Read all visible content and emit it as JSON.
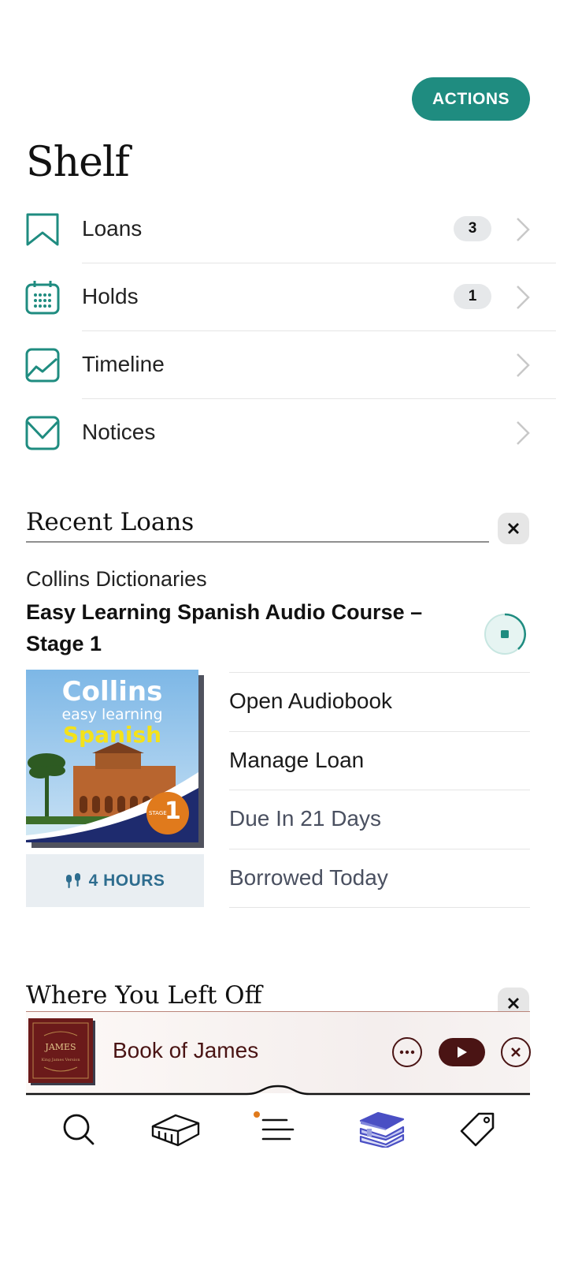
{
  "header": {
    "actions_label": "ACTIONS",
    "title": "Shelf"
  },
  "menu": [
    {
      "label": "Loans",
      "badge": "3",
      "icon": "bookmark-icon"
    },
    {
      "label": "Holds",
      "badge": "1",
      "icon": "calendar-icon"
    },
    {
      "label": "Timeline",
      "badge": null,
      "icon": "chart-icon"
    },
    {
      "label": "Notices",
      "badge": null,
      "icon": "envelope-icon"
    }
  ],
  "recent_loans": {
    "title": "Recent Loans",
    "author": "Collins Dictionaries",
    "book_title": "Easy Learning Spanish Audio Course – Stage 1",
    "cover": {
      "brand": "Collins",
      "line1": "easy learning",
      "line2": "Spanish",
      "stage_label": "STAGE",
      "stage_num": "1"
    },
    "duration": "4 HOURS",
    "actions": [
      "Open Audiobook",
      "Manage Loan",
      "Due In 21 Days",
      "Borrowed Today"
    ]
  },
  "where_you_left_off": {
    "title": "Where You Left Off"
  },
  "player": {
    "title": "Book of James",
    "cover": {
      "line1": "JAMES",
      "line2": "King James Version"
    }
  },
  "bottom_nav": [
    "search-icon",
    "library-icon",
    "menu-icon",
    "shelf-books-icon",
    "tag-icon"
  ],
  "colors": {
    "accent": "#1f8c80",
    "player": "#4a1414",
    "shelf_active": "#4a4fc4"
  }
}
